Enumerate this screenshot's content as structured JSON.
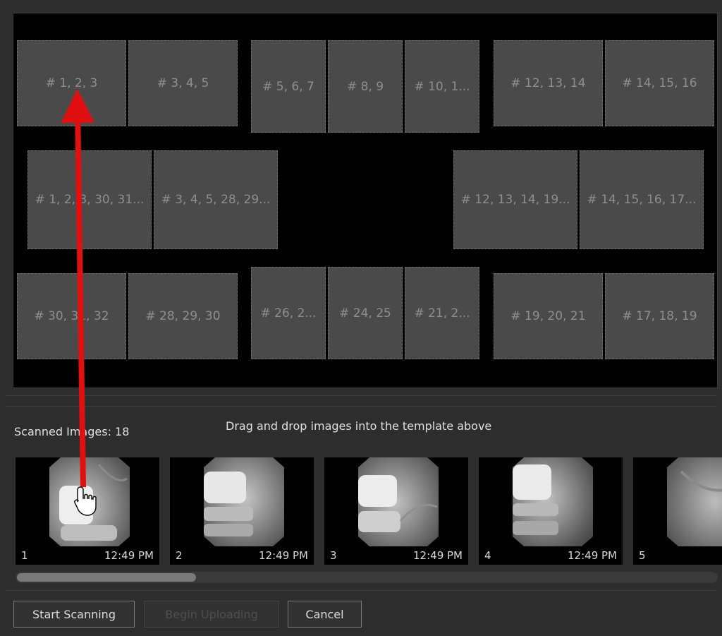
{
  "template": {
    "slots": [
      {
        "label": "# 1, 2, 3"
      },
      {
        "label": "# 3, 4, 5"
      },
      {
        "label": "# 5, 6, 7"
      },
      {
        "label": "# 8, 9"
      },
      {
        "label": "# 10, 1..."
      },
      {
        "label": "# 12, 13, 14"
      },
      {
        "label": "# 14, 15, 16"
      },
      {
        "label": "# 1, 2, 3, 30, 31..."
      },
      {
        "label": "# 3, 4, 5, 28, 29..."
      },
      {
        "label": "# 12, 13, 14, 19..."
      },
      {
        "label": "# 14, 15, 16, 17..."
      },
      {
        "label": "# 30, 31, 32"
      },
      {
        "label": "# 28, 29, 30"
      },
      {
        "label": "# 26, 2..."
      },
      {
        "label": "# 24, 25"
      },
      {
        "label": "# 21, 2..."
      },
      {
        "label": "# 19, 20, 21"
      },
      {
        "label": "# 17, 18, 19"
      }
    ]
  },
  "scanned": {
    "label": "Scanned Images: 18"
  },
  "instruction": "Drag and drop images into the template above",
  "thumbnails": [
    {
      "num": "1",
      "time": "12:49 PM"
    },
    {
      "num": "2",
      "time": "12:49 PM"
    },
    {
      "num": "3",
      "time": "12:49 PM"
    },
    {
      "num": "4",
      "time": "12:49 PM"
    },
    {
      "num": "5",
      "time": ""
    }
  ],
  "buttons": {
    "start": "Start Scanning",
    "upload": "Begin Uploading",
    "cancel": "Cancel"
  },
  "colors": {
    "arrow": "#e01010",
    "slot": "#4a4a4a",
    "background": "#2d2d2d"
  },
  "icons": {
    "cursor": "hand-pointer-icon"
  }
}
